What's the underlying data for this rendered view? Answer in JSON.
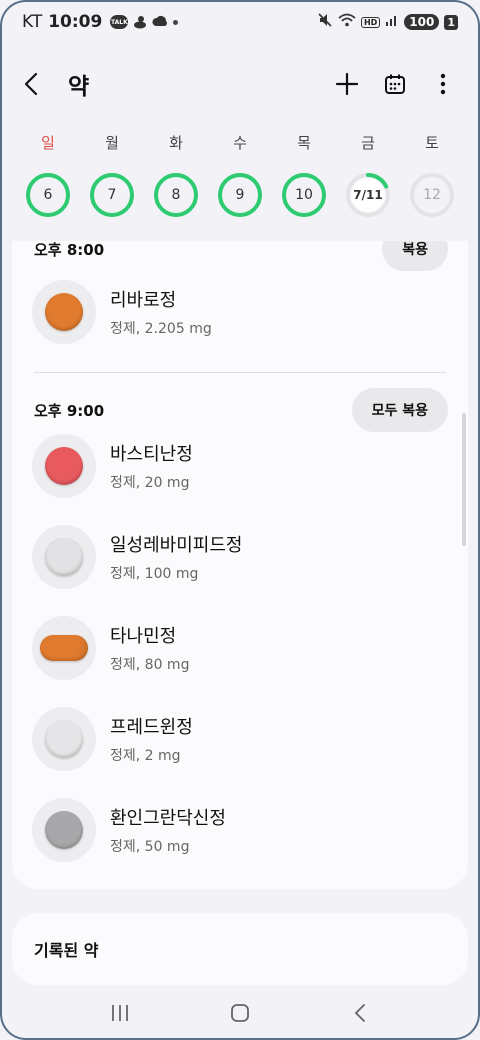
{
  "status": {
    "carrier": "KT",
    "time": "10:09",
    "talk_badge": "TALK",
    "hd_badge": "HD",
    "battery": "100",
    "sim": "1"
  },
  "header": {
    "title": "약"
  },
  "week": {
    "days": [
      {
        "label": "일",
        "date": "6",
        "progress": 1.0,
        "state": "done"
      },
      {
        "label": "월",
        "date": "7",
        "progress": 1.0,
        "state": "done"
      },
      {
        "label": "화",
        "date": "8",
        "progress": 1.0,
        "state": "done"
      },
      {
        "label": "수",
        "date": "9",
        "progress": 1.0,
        "state": "done"
      },
      {
        "label": "목",
        "date": "10",
        "progress": 1.0,
        "state": "done"
      },
      {
        "label": "금",
        "date": "7/11",
        "progress": 0.18,
        "state": "selected"
      },
      {
        "label": "토",
        "date": "12",
        "progress": 0,
        "state": "future"
      }
    ]
  },
  "sections": [
    {
      "time": "오후 8:00",
      "action_label": "복용",
      "meds": [
        {
          "name": "리바로정",
          "desc": "정제, 2.205 mg",
          "color": "#e07a2e",
          "shape": "round"
        }
      ]
    },
    {
      "time": "오후 9:00",
      "action_label": "모두 복용",
      "meds": [
        {
          "name": "바스티난정",
          "desc": "정제, 20 mg",
          "color": "#e85a5e",
          "shape": "round"
        },
        {
          "name": "일성레바미피드정",
          "desc": "정제, 100 mg",
          "color": "#e2e2e4",
          "shape": "round"
        },
        {
          "name": "타나민정",
          "desc": "정제, 80 mg",
          "color": "#e07a2e",
          "shape": "oval"
        },
        {
          "name": "프레드윈정",
          "desc": "정제, 2 mg",
          "color": "#e6e6e8",
          "shape": "round"
        },
        {
          "name": "환인그란닥신정",
          "desc": "정제, 50 mg",
          "color": "#a8a8aa",
          "shape": "round"
        }
      ]
    }
  ],
  "recorded": {
    "title": "기록된 약"
  },
  "colors": {
    "ring_green": "#2ecc71",
    "ring_track": "#e4e4e6",
    "sunday_red": "#e0524b"
  }
}
